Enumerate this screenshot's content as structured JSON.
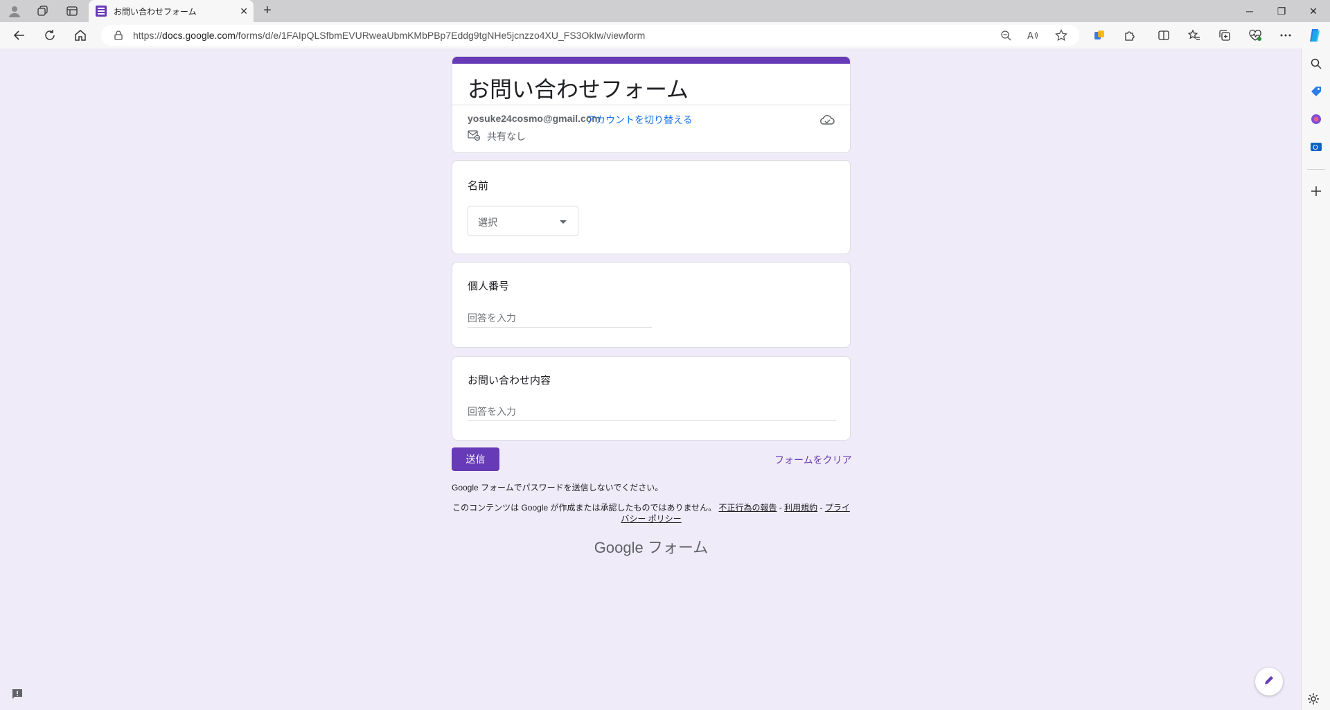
{
  "browser": {
    "tab_title": "お問い合わせフォーム",
    "url_prefix": "https://",
    "url_domain": "docs.google.com",
    "url_path": "/forms/d/e/1FAIpQLSfbmEVURweaUbmKMbPBp7Eddg9tgNHe5jcnzzo4XU_FS3OkIw/viewform",
    "icons": {
      "profile": "profile-icon",
      "workspaces": "workspaces-icon",
      "tab_actions": "tab-actions-icon",
      "new_tab": "plus-icon",
      "back": "back-arrow-icon",
      "refresh": "refresh-icon",
      "home": "home-icon",
      "zoom": "zoom-out-icon",
      "read_aloud": "read-aloud-icon",
      "favorite": "star-icon",
      "extensions": "puzzle-icon",
      "split": "split-screen-icon",
      "favorites": "favorites-icon",
      "collections": "collections-icon",
      "performance": "heart-icon",
      "more": "ellipsis-icon",
      "copilot": "copilot-icon"
    }
  },
  "form": {
    "title": "お問い合わせフォーム",
    "account_email": "yosuke24cosmo@gmail.com",
    "switch_account": "アカウントを切り替える",
    "share_status": "共有なし",
    "questions": [
      {
        "title": "名前",
        "type": "dropdown",
        "placeholder": "選択"
      },
      {
        "title": "個人番号",
        "type": "short_text",
        "placeholder": "回答を入力"
      },
      {
        "title": "お問い合わせ内容",
        "type": "paragraph",
        "placeholder": "回答を入力"
      }
    ],
    "submit_label": "送信",
    "clear_label": "フォームをクリア",
    "password_warning": "Google フォームでパスワードを送信しないでください。",
    "disclaimer_text": "このコンテンツは Google が作成または承認したものではありません。",
    "report_link": "不正行為の報告",
    "terms_link": "利用規約",
    "privacy_link": "プライバシー ポリシー",
    "separator": " - ",
    "footer_brand": "Google",
    "footer_product": "フォーム"
  },
  "colors": {
    "accent": "#673ab7",
    "background": "#f0ebf8",
    "link": "#1a73e8"
  }
}
